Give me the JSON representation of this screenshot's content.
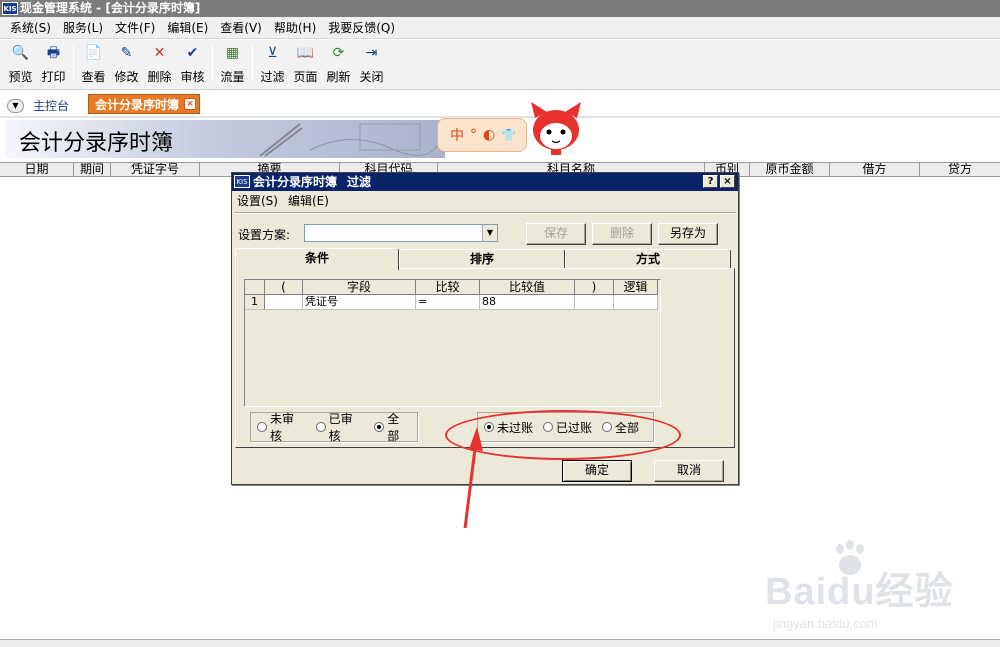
{
  "window": {
    "title": "现金管理系统 - [会计分录序时簿]",
    "logo": "KIS"
  },
  "menubar": {
    "items": [
      "系统(S)",
      "服务(L)",
      "文件(F)",
      "编辑(E)",
      "查看(V)",
      "帮助(H)",
      "我要反馈(Q)"
    ]
  },
  "toolbar": {
    "groups": [
      [
        {
          "label": "预览",
          "icon": "preview-icon",
          "glyph": "🔍"
        },
        {
          "label": "打印",
          "icon": "print-icon",
          "glyph": "🖶"
        }
      ],
      [
        {
          "label": "查看",
          "icon": "view-icon",
          "glyph": "📄"
        },
        {
          "label": "修改",
          "icon": "edit-icon",
          "glyph": "✎"
        },
        {
          "label": "删除",
          "icon": "delete-icon",
          "glyph": "✕"
        },
        {
          "label": "审核",
          "icon": "audit-icon",
          "glyph": "✔"
        }
      ],
      [
        {
          "label": "流量",
          "icon": "cashflow-icon",
          "glyph": "▦"
        }
      ],
      [
        {
          "label": "过滤",
          "icon": "filter-icon",
          "glyph": "⊻"
        },
        {
          "label": "页面",
          "icon": "page-icon",
          "glyph": "📖"
        },
        {
          "label": "刷新",
          "icon": "refresh-icon",
          "glyph": "⟳"
        },
        {
          "label": "关闭",
          "icon": "close-icon",
          "glyph": "⇥"
        }
      ]
    ]
  },
  "tabs": {
    "home": "主控台",
    "active": "会计分录序时簿",
    "close_glyph": "×"
  },
  "banner": {
    "title": "会计分录序时簿",
    "bubble_text": "中",
    "bubble_icons": [
      "°",
      "◐",
      "👕"
    ]
  },
  "grid": {
    "columns": [
      "日期",
      "期间",
      "凭证字号",
      "摘要",
      "科目代码",
      "科目名称",
      "币别",
      "原币金额",
      "借方",
      "贷方"
    ]
  },
  "dialog": {
    "logo": "KIS",
    "title_main": "会计分录序时簿",
    "title_sub": "过滤",
    "help_glyph": "?",
    "close_glyph": "×",
    "menu": [
      "设置(S)",
      "编辑(E)"
    ],
    "scheme_label": "设置方案:",
    "scheme_value": "",
    "buttons": {
      "save": "保存",
      "delete": "删除",
      "save_as": "另存为",
      "ok": "确定",
      "cancel": "取消"
    },
    "tabs": [
      "条件",
      "排序",
      "方式"
    ],
    "condition_grid": {
      "headers": [
        "",
        "(",
        "字段",
        "比较",
        "比较值",
        ")",
        "逻辑"
      ],
      "rows": [
        [
          "1",
          "",
          "凭证号",
          "=",
          "88",
          "",
          ""
        ]
      ]
    },
    "audit_group": [
      {
        "label": "未审核",
        "checked": false
      },
      {
        "label": "已审核",
        "checked": false
      },
      {
        "label": "全部",
        "checked": true
      }
    ],
    "post_group": [
      {
        "label": "未过账",
        "checked": true
      },
      {
        "label": "已过账",
        "checked": false
      },
      {
        "label": "全部",
        "checked": false
      }
    ]
  },
  "colors": {
    "accent_tab": "#e97a24",
    "dialog_title": "#0a246a",
    "annotation": "#e8322e"
  },
  "watermark": {
    "brand": "Baidu经验",
    "url": "jingyan.baidu.com"
  }
}
